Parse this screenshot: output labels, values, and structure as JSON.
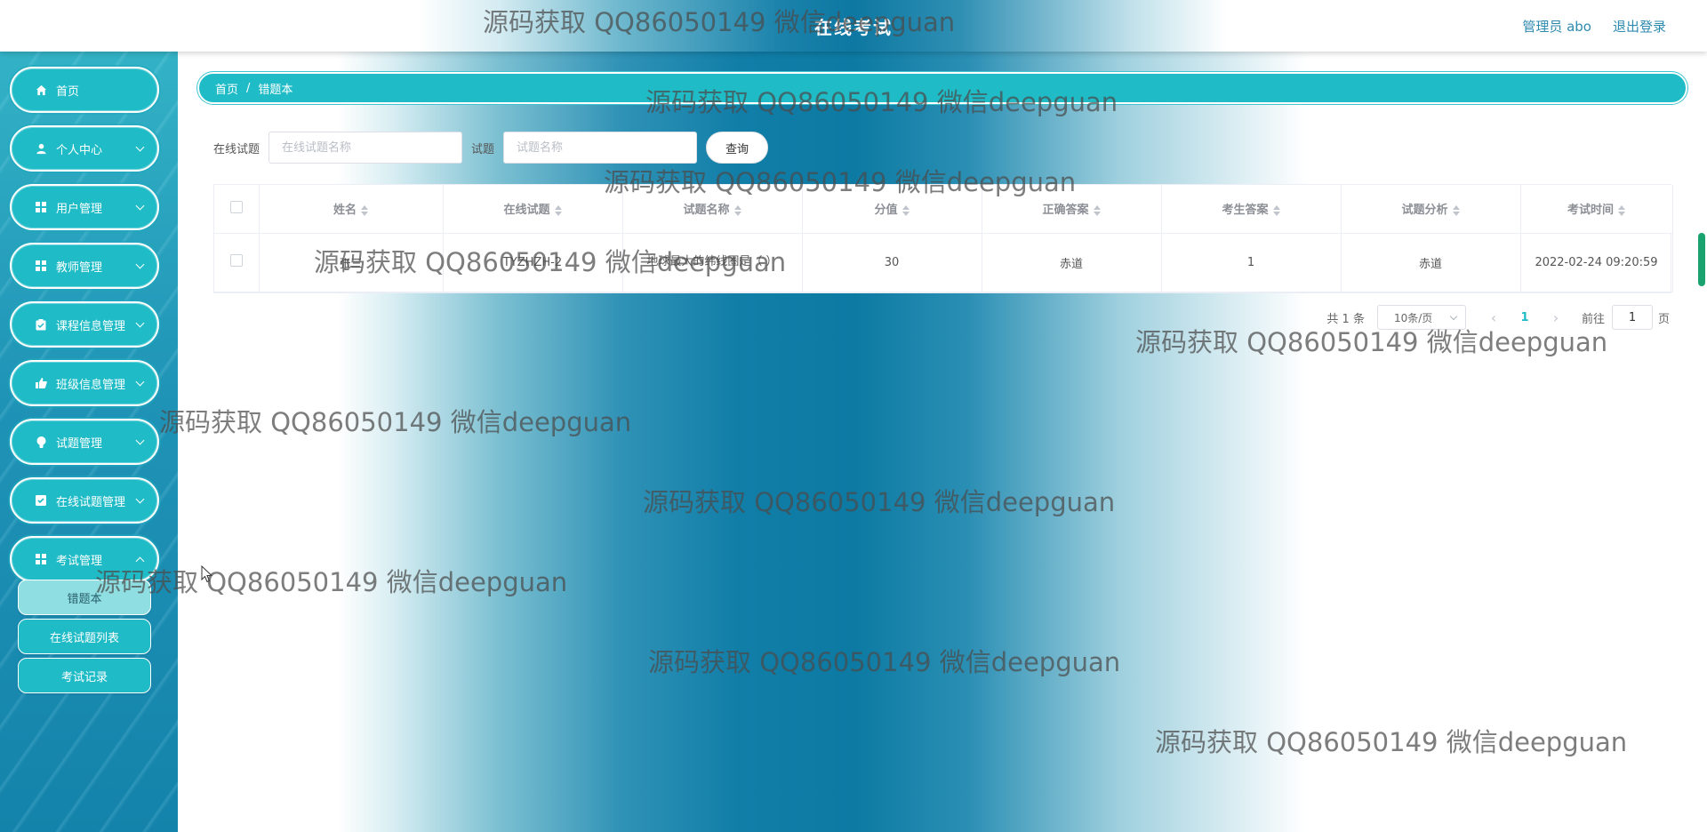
{
  "header": {
    "title": "在线考试",
    "user_label": "管理员 abo",
    "logout_label": "退出登录"
  },
  "sidebar": {
    "items": [
      {
        "label": "首页",
        "icon": "home-icon"
      },
      {
        "label": "个人中心",
        "icon": "person-icon"
      },
      {
        "label": "用户管理",
        "icon": "grid-icon"
      },
      {
        "label": "教师管理",
        "icon": "grid-icon"
      },
      {
        "label": "课程信息管理",
        "icon": "clipboard-icon"
      },
      {
        "label": "班级信息管理",
        "icon": "thumb-icon"
      },
      {
        "label": "试题管理",
        "icon": "bulb-icon"
      },
      {
        "label": "在线试题管理",
        "icon": "check-square-icon"
      },
      {
        "label": "考试管理",
        "icon": "grid-icon"
      }
    ],
    "submenu": [
      {
        "label": "错题本",
        "active": true
      },
      {
        "label": "在线试题列表",
        "active": false
      },
      {
        "label": "考试记录",
        "active": false
      }
    ]
  },
  "breadcrumb": {
    "home": "首页",
    "separator": "/",
    "current": "错题本"
  },
  "search": {
    "exam_label": "在线试题",
    "exam_placeholder": "在线试题名称",
    "question_label": "试题",
    "question_placeholder": "试题名称",
    "query_button": "查询"
  },
  "table": {
    "columns": [
      "姓名",
      "在线试题",
      "试题名称",
      "分值",
      "正确答案",
      "考生答案",
      "试题分析",
      "考试时间"
    ],
    "rows": [
      {
        "name": "张三",
        "exam": "TYZHZH-2",
        "question": "地球最大的纬线圈是（  ）",
        "score": "30",
        "correct_answer": "赤道",
        "student_answer": "1",
        "analysis": "赤道",
        "exam_time": "2022-02-24 09:20:59"
      }
    ]
  },
  "pagination": {
    "total": "共 1 条",
    "page_size": "10条/页",
    "prev": "‹",
    "current_page": "1",
    "next": "›",
    "goto_label": "前往",
    "goto_value": "1",
    "goto_unit": "页"
  },
  "watermark": {
    "text": "源码获取 QQ86050149 微信deepguan"
  },
  "colors": {
    "accent": "#1fbcc7",
    "link": "#2f8ab0"
  }
}
